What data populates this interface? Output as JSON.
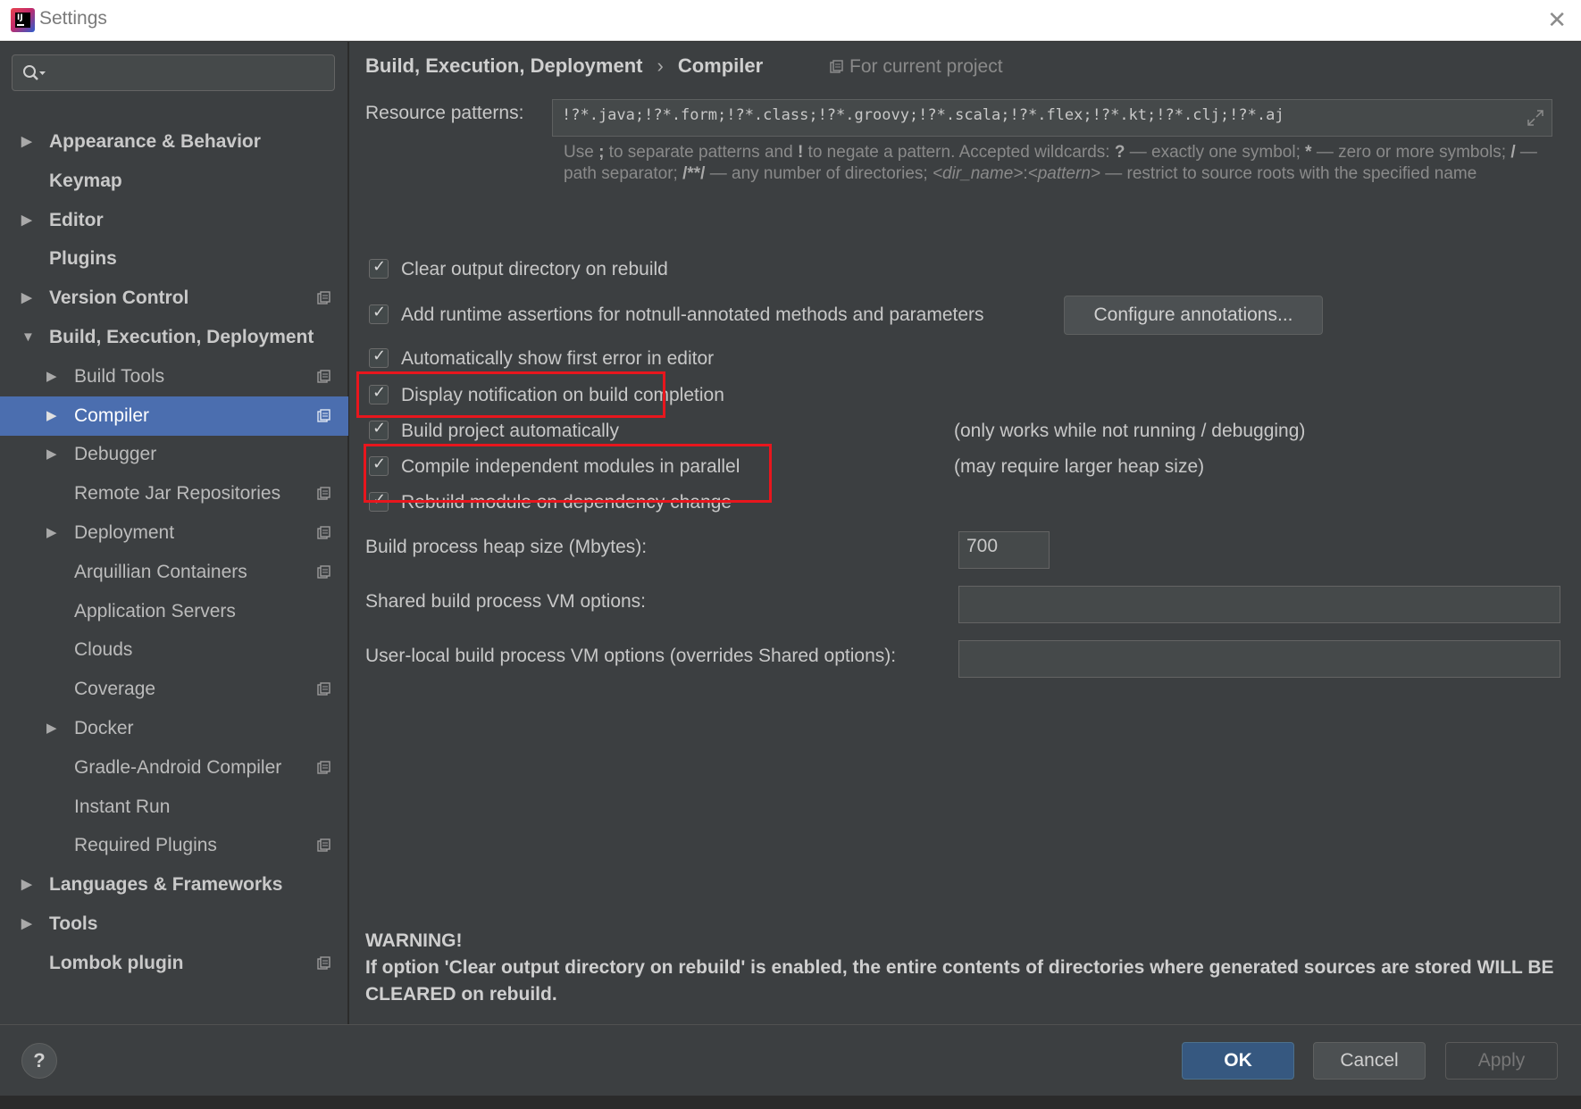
{
  "window": {
    "title": "Settings",
    "app_logo_text": "IJ"
  },
  "search": {
    "placeholder": "",
    "value": ""
  },
  "sidebar": {
    "items": [
      {
        "label": "Appearance & Behavior",
        "level": 0,
        "bold": true,
        "arrow": "right",
        "project_icon": false,
        "selected": false
      },
      {
        "label": "Keymap",
        "level": 0,
        "bold": true,
        "arrow": "",
        "project_icon": false,
        "selected": false
      },
      {
        "label": "Editor",
        "level": 0,
        "bold": true,
        "arrow": "right",
        "project_icon": false,
        "selected": false
      },
      {
        "label": "Plugins",
        "level": 0,
        "bold": true,
        "arrow": "",
        "project_icon": false,
        "selected": false
      },
      {
        "label": "Version Control",
        "level": 0,
        "bold": true,
        "arrow": "right",
        "project_icon": true,
        "selected": false
      },
      {
        "label": "Build, Execution, Deployment",
        "level": 0,
        "bold": true,
        "arrow": "down",
        "project_icon": false,
        "selected": false
      },
      {
        "label": "Build Tools",
        "level": 1,
        "bold": false,
        "arrow": "right",
        "project_icon": true,
        "selected": false
      },
      {
        "label": "Compiler",
        "level": 1,
        "bold": false,
        "arrow": "right",
        "project_icon": true,
        "selected": true
      },
      {
        "label": "Debugger",
        "level": 1,
        "bold": false,
        "arrow": "right",
        "project_icon": false,
        "selected": false
      },
      {
        "label": "Remote Jar Repositories",
        "level": 1,
        "bold": false,
        "arrow": "",
        "project_icon": true,
        "selected": false
      },
      {
        "label": "Deployment",
        "level": 1,
        "bold": false,
        "arrow": "right",
        "project_icon": true,
        "selected": false
      },
      {
        "label": "Arquillian Containers",
        "level": 1,
        "bold": false,
        "arrow": "",
        "project_icon": true,
        "selected": false
      },
      {
        "label": "Application Servers",
        "level": 1,
        "bold": false,
        "arrow": "",
        "project_icon": false,
        "selected": false
      },
      {
        "label": "Clouds",
        "level": 1,
        "bold": false,
        "arrow": "",
        "project_icon": false,
        "selected": false
      },
      {
        "label": "Coverage",
        "level": 1,
        "bold": false,
        "arrow": "",
        "project_icon": true,
        "selected": false
      },
      {
        "label": "Docker",
        "level": 1,
        "bold": false,
        "arrow": "right",
        "project_icon": false,
        "selected": false
      },
      {
        "label": "Gradle-Android Compiler",
        "level": 1,
        "bold": false,
        "arrow": "",
        "project_icon": true,
        "selected": false
      },
      {
        "label": "Instant Run",
        "level": 1,
        "bold": false,
        "arrow": "",
        "project_icon": false,
        "selected": false
      },
      {
        "label": "Required Plugins",
        "level": 1,
        "bold": false,
        "arrow": "",
        "project_icon": true,
        "selected": false
      },
      {
        "label": "Languages & Frameworks",
        "level": 0,
        "bold": true,
        "arrow": "right",
        "project_icon": false,
        "selected": false
      },
      {
        "label": "Tools",
        "level": 0,
        "bold": true,
        "arrow": "right",
        "project_icon": false,
        "selected": false
      },
      {
        "label": "Lombok plugin",
        "level": 0,
        "bold": true,
        "arrow": "",
        "project_icon": true,
        "selected": false
      }
    ]
  },
  "header": {
    "breadcrumb_parent": "Build, Execution, Deployment",
    "breadcrumb_separator": "›",
    "breadcrumb_current": "Compiler",
    "scope_label": "For current project"
  },
  "resource": {
    "label": "Resource patterns:",
    "value": "!?*.java;!?*.form;!?*.class;!?*.groovy;!?*.scala;!?*.flex;!?*.kt;!?*.clj;!?*.aj",
    "hint_1": "Use ",
    "hint_semicolon": ";",
    "hint_2": " to separate patterns and ",
    "hint_bang": "!",
    "hint_3": " to negate a pattern. Accepted wildcards: ",
    "hint_q": "?",
    "hint_4": " — exactly one symbol; ",
    "hint_star": "*",
    "hint_5": " — zero or more symbols; ",
    "hint_slash": "/",
    "hint_6": " — path separator; ",
    "hint_dstar": "/**/",
    "hint_7": " — any number of directories; ",
    "hint_dir": "<dir_name>",
    "hint_colon": ":",
    "hint_pattern": "<pattern>",
    "hint_8": " — restrict to source roots with the specified name"
  },
  "options": {
    "clear_output": "Clear output directory on rebuild",
    "runtime_assertions": "Add runtime assertions for notnull-annotated methods and parameters",
    "configure_annotations": "Configure annotations...",
    "show_first_error": "Automatically show first error in editor",
    "display_notification": "Display notification on build completion",
    "build_automatically": "Build project automatically",
    "build_automatically_note": "(only works while not running / debugging)",
    "compile_parallel": "Compile independent modules in parallel",
    "compile_parallel_note": "(may require larger heap size)",
    "rebuild_on_dependency": "Rebuild module on dependency change"
  },
  "heap": {
    "label": "Build process heap size (Mbytes):",
    "value": "700"
  },
  "vm": {
    "shared_label": "Shared build process VM options:",
    "shared_value": "",
    "user_label": "User-local build process VM options (overrides Shared options):",
    "user_value": ""
  },
  "warning": {
    "title": "WARNING!",
    "body": "If option 'Clear output directory on rebuild' is enabled, the entire contents of directories where generated sources are stored WILL BE CLEARED on rebuild."
  },
  "buttons": {
    "help": "?",
    "ok": "OK",
    "cancel": "Cancel",
    "apply": "Apply"
  },
  "colors": {
    "selection": "#4b6eaf",
    "highlight_box": "#e8161d",
    "panel_bg": "#3c3f41",
    "primary_button": "#365880"
  }
}
